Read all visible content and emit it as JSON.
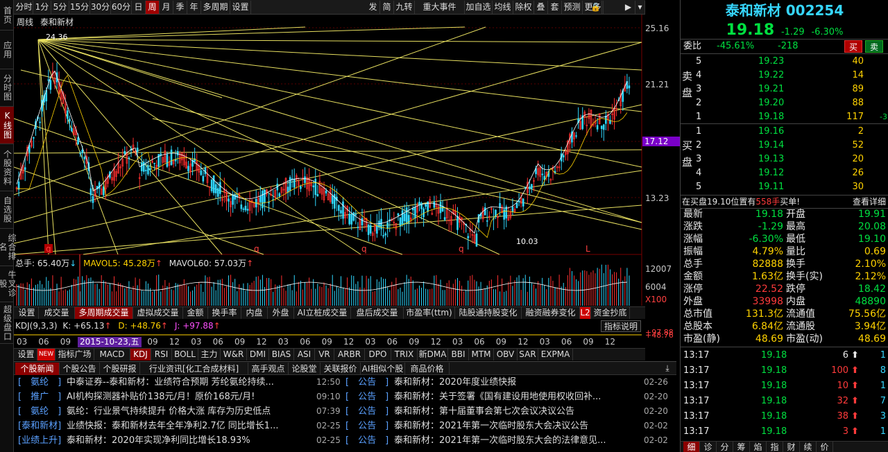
{
  "left_nav": [
    "首页",
    "应用",
    "分时图",
    "K线图",
    "个股资料",
    "自选股",
    "综合排名",
    "牛叉诊股",
    "超级盘口"
  ],
  "left_nav_active": 3,
  "toolbar": {
    "periods": [
      "分时",
      "1分",
      "5分",
      "15分",
      "30分",
      "60分",
      "日",
      "周",
      "月",
      "季",
      "年",
      "多周期",
      "设置"
    ],
    "active_period": 7,
    "right": [
      "发",
      "简",
      "九转",
      "重大事件",
      "加自选",
      "均线",
      "除权",
      "叠",
      "套",
      "预测",
      "更多"
    ]
  },
  "chart": {
    "label_period": "周线",
    "label_name": "泰和新材",
    "high_annot": "24.36",
    "low_annot": "10.03",
    "price_ticks": [
      "25.16",
      "21.21",
      "17.12",
      "13.23"
    ],
    "current_price_tag": "17.12",
    "date_tag": "2015-10-23,五",
    "vol_ticks": [
      "12007",
      "6004",
      "X100"
    ],
    "kdj_ticks": [
      "+97.88",
      "+48.76"
    ],
    "markers": [
      "q",
      "q",
      "q",
      "q",
      "L"
    ]
  },
  "vol_legend": {
    "total": "总手: 65.40万",
    "mavol5": "MAVOL5: 45.28万",
    "mavol60": "MAVOL60: 57.03万"
  },
  "kdj_legend": {
    "name": "KDJ(9,3,3)",
    "k": "K: +65.13",
    "d": "D: +48.76",
    "j": "J: +97.88",
    "help": "指标说明"
  },
  "ind_tabs1": [
    "设置",
    "成交量",
    "多周期成交量",
    "虚拟成交量",
    "金额",
    "换手率",
    "内盘",
    "外盘",
    "AI立桩成交量",
    "盘后成交量",
    "市盈率(ttm)",
    "陆股通持股变化",
    "融资融券变化",
    "资金抄底"
  ],
  "ind_tabs1_active": 2,
  "ind_badge": "L2",
  "ind_tabs2": [
    "设置",
    "指标广场",
    "MACD",
    "KDJ",
    "RSI",
    "BOLL",
    "主力",
    "W&R",
    "DMI",
    "BIAS",
    "ASI",
    "VR",
    "ARBR",
    "DPO",
    "TRIX",
    "新DMA",
    "BBI",
    "MTM",
    "OBV",
    "SAR",
    "EXPMA"
  ],
  "ind_tabs2_active": 3,
  "new_badge": "NEW",
  "x_years": [
    "03",
    "06",
    "09",
    "12",
    "03",
    "06",
    "09",
    "12",
    "03",
    "06",
    "09",
    "12",
    "03",
    "06",
    "09",
    "12",
    "03",
    "06",
    "09",
    "12",
    "03",
    "06",
    "09",
    "12",
    "03",
    "06",
    "09",
    "12"
  ],
  "news_tabs": [
    "个股新闻",
    "个股公告",
    "个股研报",
    "行业资讯[化工合成材料]",
    "高手观点",
    "论股堂",
    "关联报价",
    "AI相似个股",
    "商品价格"
  ],
  "news_active": 0,
  "news_left": [
    {
      "tag": "[　氨纶　]",
      "title": "中泰证券--泰和新材：业绩符合预期 芳纶氨纶持续...",
      "time": "12:50"
    },
    {
      "tag": "[　推广　]",
      "title": "AI机构探测器补贴价138元/月！原价168元/月!",
      "time": "09:10"
    },
    {
      "tag": "[　氨纶　]",
      "title": "氨纶：行业景气持续提升 价格大涨 库存为历史低点",
      "time": "07:39"
    },
    {
      "tag": "[泰和新材]",
      "title": "业绩快报：泰和新材去年全年净利2.7亿 同比增长1...",
      "time": "02-25"
    },
    {
      "tag": "[业绩上升]",
      "title": "泰和新材：2020年实现净利同比增长18.93%",
      "time": "02-25"
    }
  ],
  "news_right": [
    {
      "tag": "[　公告　]",
      "title": "泰和新材：2020年度业绩快报",
      "time": "02-26"
    },
    {
      "tag": "[　公告　]",
      "title": "泰和新材：关于签署《国有建设用地使用权收回补...",
      "time": "02-20"
    },
    {
      "tag": "[　公告　]",
      "title": "泰和新材：第十届董事会第七次会议决议公告",
      "time": "02-20"
    },
    {
      "tag": "[　公告　]",
      "title": "泰和新材：2021年第一次临时股东大会决议公告",
      "time": "02-02"
    },
    {
      "tag": "[　公告　]",
      "title": "泰和新材：2021年第一次临时股东大会的法律意见...",
      "time": "02-02"
    }
  ],
  "quote": {
    "name": "泰和新材",
    "code": "002254",
    "price": "19.18",
    "change": "-1.29",
    "pct": "-6.30%",
    "weibi_label": "委比",
    "weibi": "-45.61%",
    "weicha": "-218",
    "buy_btn": "买",
    "sell_btn": "卖",
    "sell_label": "卖盘",
    "buy_label": "买盘",
    "asks": [
      {
        "lvl": "5",
        "price": "19.23",
        "vol": "40",
        "chg": ""
      },
      {
        "lvl": "4",
        "price": "19.22",
        "vol": "14",
        "chg": ""
      },
      {
        "lvl": "3",
        "price": "19.21",
        "vol": "89",
        "chg": ""
      },
      {
        "lvl": "2",
        "price": "19.20",
        "vol": "88",
        "chg": ""
      },
      {
        "lvl": "1",
        "price": "19.18",
        "vol": "117",
        "chg": "-3"
      }
    ],
    "bids": [
      {
        "lvl": "1",
        "price": "19.16",
        "vol": "2"
      },
      {
        "lvl": "2",
        "price": "19.14",
        "vol": "52"
      },
      {
        "lvl": "3",
        "price": "19.13",
        "vol": "20"
      },
      {
        "lvl": "4",
        "price": "19.12",
        "vol": "26"
      },
      {
        "lvl": "5",
        "price": "19.11",
        "vol": "30"
      }
    ],
    "notice_pre": "在买盘19.10位置有",
    "notice_qty": "558手",
    "notice_post": "买单!",
    "notice_link": "查看详细",
    "stats": [
      [
        "最新",
        "19.18",
        "开盘",
        "19.91"
      ],
      [
        "涨跌",
        "-1.29",
        "最高",
        "20.08"
      ],
      [
        "涨幅",
        "-6.30%",
        "最低",
        "19.10"
      ],
      [
        "振幅",
        "4.79%",
        "量比",
        "0.69"
      ],
      [
        "总手",
        "82888",
        "换手",
        "2.10%"
      ],
      [
        "金额",
        "1.63亿",
        "换手(实)",
        "2.12%"
      ],
      [
        "涨停",
        "22.52",
        "跌停",
        "18.42"
      ],
      [
        "外盘",
        "33998",
        "内盘",
        "48890"
      ],
      [
        "总市值",
        "131.3亿",
        "流通值",
        "75.56亿"
      ],
      [
        "总股本",
        "6.84亿",
        "流通股",
        "3.94亿"
      ],
      [
        "市盈(静)",
        "48.69",
        "市盈(动)",
        "48.69"
      ]
    ],
    "ticks": [
      {
        "time": "13:17",
        "price": "19.18",
        "vol": "6",
        "n": "1"
      },
      {
        "time": "13:17",
        "price": "19.18",
        "vol": "100",
        "n": "8"
      },
      {
        "time": "13:17",
        "price": "19.18",
        "vol": "10",
        "n": "1"
      },
      {
        "time": "13:17",
        "price": "19.18",
        "vol": "32",
        "n": "7"
      },
      {
        "time": "13:17",
        "price": "19.18",
        "vol": "38",
        "n": "3"
      },
      {
        "time": "13:17",
        "price": "19.18",
        "vol": "3",
        "n": "1"
      }
    ],
    "bottom_tabs": [
      "细",
      "诊",
      "分",
      "筹",
      "焰",
      "指",
      "财",
      "续",
      "价"
    ]
  },
  "colors": {
    "up": "#ff3b3b",
    "down": "#00e040",
    "wick": "#ff4040",
    "cyan": "#36d6ff",
    "yellow": "#f0e060"
  }
}
